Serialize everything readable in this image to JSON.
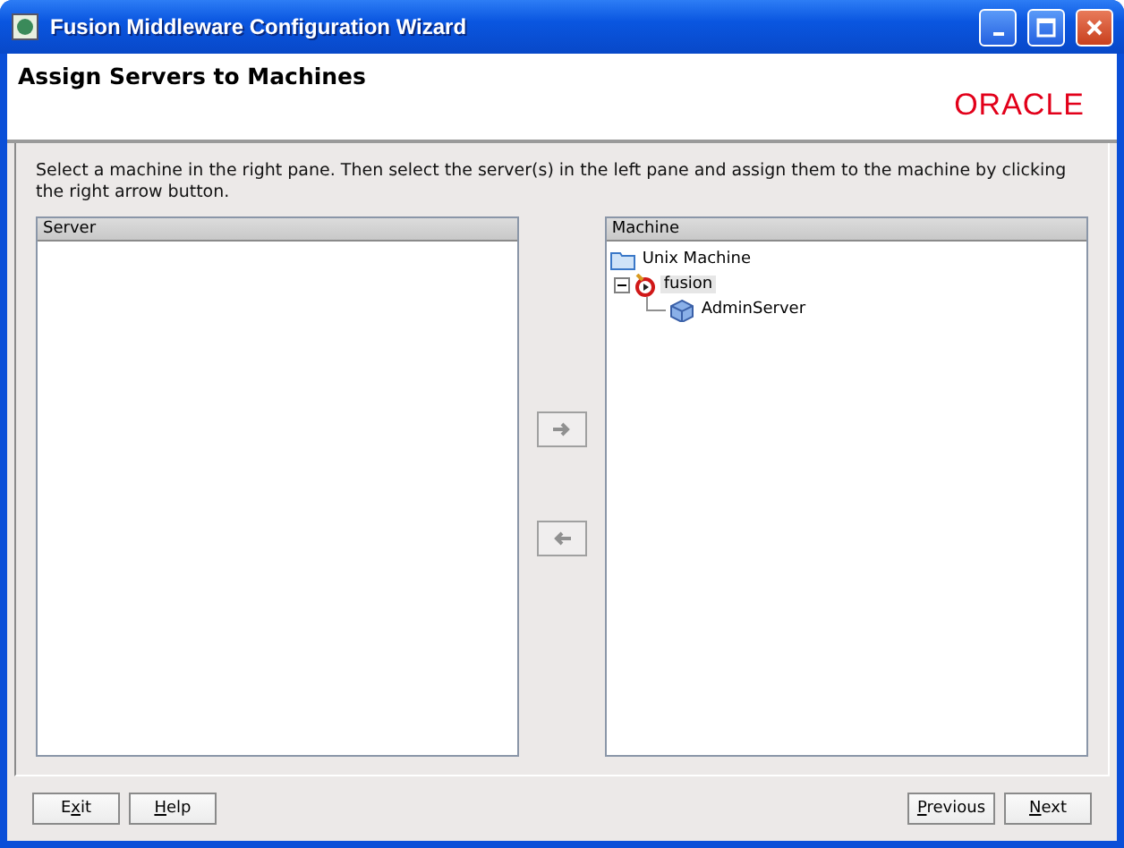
{
  "window": {
    "title": "Fusion Middleware Configuration Wizard"
  },
  "header": {
    "title": "Assign Servers to Machines",
    "logo": "ORACLE"
  },
  "instructions": "Select a machine in the right pane. Then select the server(s) in the left pane and assign them to the machine by clicking the right arrow button.",
  "server_pane": {
    "heading": "Server"
  },
  "transfer_buttons": [
    {
      "kind": "right",
      "disabled": true
    },
    {
      "kind": "left",
      "disabled": true
    }
  ],
  "machine_pane": {
    "heading": "Machine",
    "tree": [
      {
        "label": "Unix Machine",
        "kind": "folder",
        "selected": false,
        "children": [
          {
            "label": "fusion",
            "kind": "machine",
            "selected": true,
            "expanded": true,
            "children": [
              {
                "label": "AdminServer",
                "kind": "server",
                "selected": false
              }
            ]
          }
        ]
      }
    ]
  },
  "left_buttons": [
    {
      "label_before": "E",
      "mnemonic": "x",
      "label_after": "it"
    },
    {
      "mnemonic": "H",
      "label_after": "elp"
    }
  ],
  "right_buttons": [
    {
      "mnemonic": "P",
      "label_after": "revious"
    },
    {
      "mnemonic": "N",
      "label_after": "ext"
    }
  ]
}
